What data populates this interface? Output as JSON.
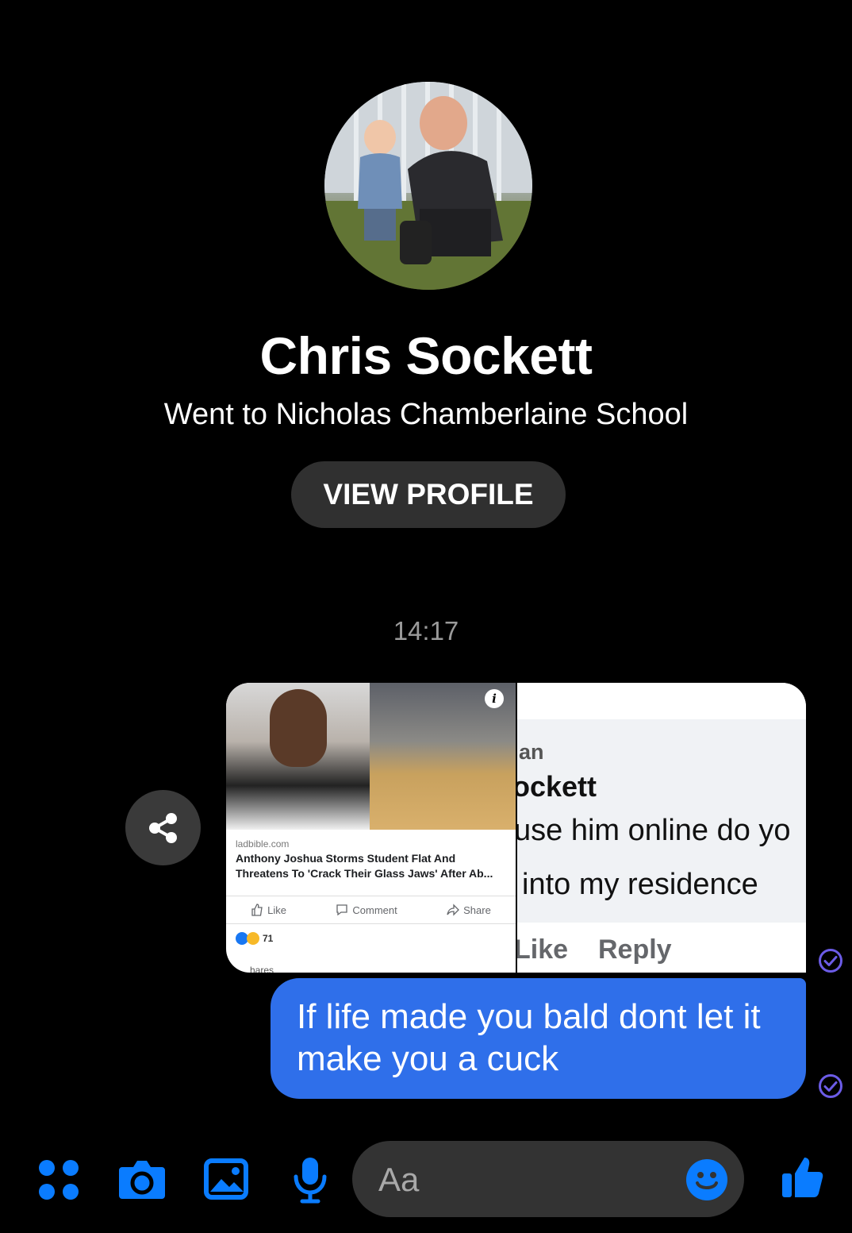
{
  "profile": {
    "name": "Chris Sockett",
    "subtitle": "Went to Nicholas Chamberlaine School",
    "view_profile_label": "VIEW PROFILE"
  },
  "timestamp": "14:17",
  "attachments": {
    "left": {
      "domain": "ladbible.com",
      "title_line1": "Anthony Joshua Storms Student Flat And",
      "title_line2": "Threatens To 'Crack Their Glass Jaws' After Ab...",
      "actions": [
        "Like",
        "Comment",
        "Share"
      ],
      "reaction_count": "71",
      "shares_text": "hares"
    },
    "right": {
      "line1": "an",
      "line2": "ockett",
      "line3": "use him online do yo",
      "line4": "into my residence",
      "like_label": "Like",
      "reply_label": "Reply"
    }
  },
  "message": {
    "text": "If life made you bald dont let it make you a cuck"
  },
  "composer": {
    "placeholder": "Aa"
  },
  "colors": {
    "accent": "#0a7cff",
    "bubble": "#2f6fea",
    "seen": "#6c5ce7"
  },
  "icons": [
    "more-icon",
    "camera-icon",
    "gallery-icon",
    "mic-icon",
    "emoji-icon",
    "thumbs-up-icon",
    "share-icon",
    "seen-check-icon"
  ]
}
